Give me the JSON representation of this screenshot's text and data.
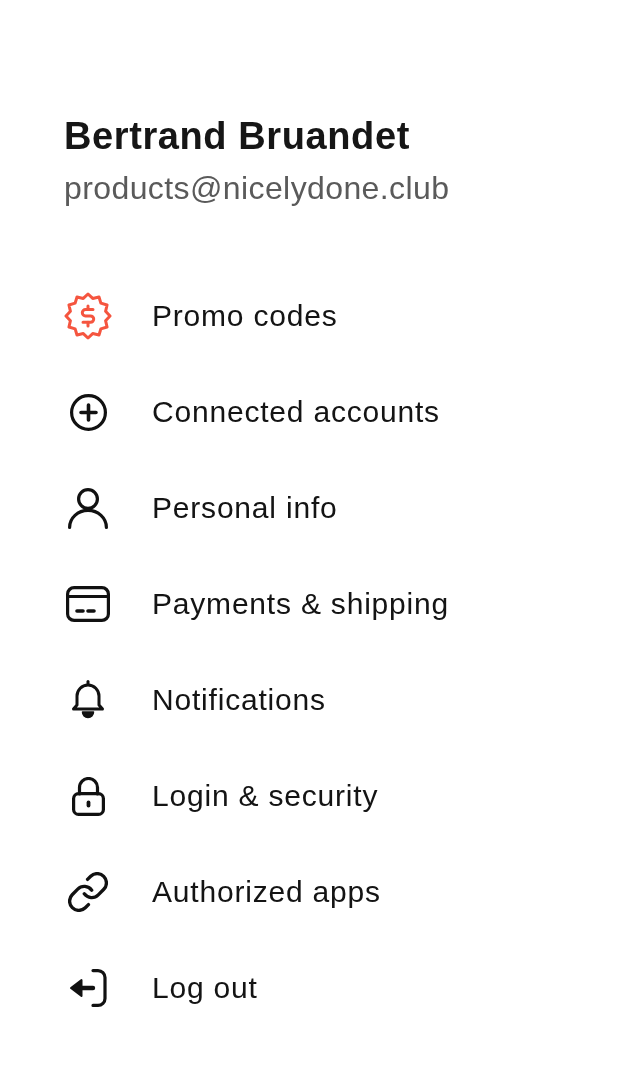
{
  "profile": {
    "name": "Bertrand Bruandet",
    "email": "products@nicelydone.club"
  },
  "menu": {
    "items": [
      {
        "kind": "promo",
        "label": "Promo codes",
        "color": "#f5553f"
      },
      {
        "kind": "connect",
        "label": "Connected accounts",
        "color": "#111111"
      },
      {
        "kind": "person",
        "label": "Personal info",
        "color": "#111111"
      },
      {
        "kind": "card",
        "label": "Payments & shipping",
        "color": "#111111"
      },
      {
        "kind": "bell",
        "label": "Notifications",
        "color": "#111111"
      },
      {
        "kind": "lock",
        "label": "Login & security",
        "color": "#111111"
      },
      {
        "kind": "link",
        "label": "Authorized apps",
        "color": "#111111"
      },
      {
        "kind": "logout",
        "label": "Log out",
        "color": "#111111"
      }
    ]
  }
}
